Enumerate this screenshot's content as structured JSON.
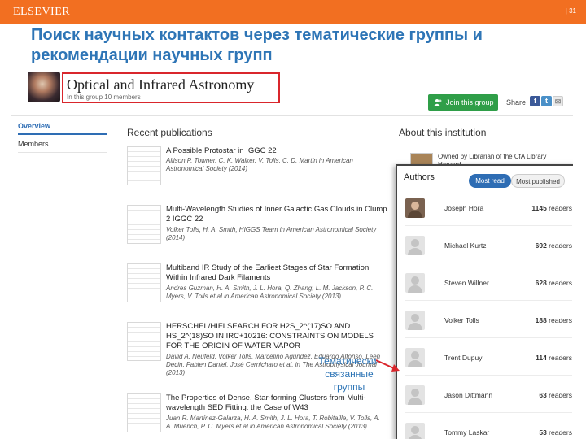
{
  "slide": {
    "brand": "ELSEVIER",
    "number": "| 31",
    "title": "Поиск научных контактов через тематические группы и рекомендации научных групп",
    "callout": "Тематически-связанные группы"
  },
  "group": {
    "name": "Optical and Infrared Astronomy",
    "meta": "In this group 10 members",
    "join_label": "Join this group",
    "share_label": "Share"
  },
  "nav": {
    "items": [
      "Overview",
      "Members"
    ]
  },
  "publications": {
    "heading": "Recent publications",
    "items": [
      {
        "title": "A Possible Protostar in IGGC 22",
        "authors": "Allison P. Towner, C. K. Walker, V. Tolls, C. D. Martin in American Astronomical Society (2014)"
      },
      {
        "title": "Multi-Wavelength Studies of Inner Galactic Gas Clouds in Clump 2 IGGC 22",
        "authors": "Volker Tolls, H. A. Smith, HIGGS Team in American Astronomical Society (2014)"
      },
      {
        "title": "Multiband IR Study of the Earliest Stages of Star Formation Within Infrared Dark Filaments",
        "authors": "Andres Guzman, H. A. Smith, J. L. Hora, Q. Zhang, L. M. Jackson, P. C. Myers, V. Tolls et al in American Astronomical Society (2013)"
      },
      {
        "title": "HERSCHEL/HIFI SEARCH FOR H2S_2^(17)SO AND HS_2^(18)SO IN IRC+10216: CONSTRAINTS ON MODELS FOR THE ORIGIN OF WATER VAPOR",
        "authors": "David A. Neufeld, Volker Tolls, Marcelino Agúndez, Eduardo Alfonso, Leen Decin, Fabien Daniel, José Cernicharo et al. in The Astrophysical Journal (2013)"
      },
      {
        "title": "The Properties of Dense, Star-forming Clusters from Multi-wavelength SED Fitting: the Case of W43",
        "authors": "Juan R. Martínez-Galarza, H. A. Smith, J. L. Hora, T. Robitaille, V. Tolls, A. A. Muench, P. C. Myers et al in American Astronomical Society (2013)"
      }
    ]
  },
  "about": {
    "heading": "About this institution",
    "text": "Owned by Librarian of the CfA Library Harvard..."
  },
  "authors": {
    "heading": "Authors",
    "tabs": [
      "Most read",
      "Most published"
    ],
    "rows": [
      {
        "name": "Joseph Hora",
        "count": "1145",
        "suffix": " readers"
      },
      {
        "name": "Michael Kurtz",
        "count": "692",
        "suffix": " readers"
      },
      {
        "name": "Steven Willner",
        "count": "628",
        "suffix": " readers"
      },
      {
        "name": "Volker Tolls",
        "count": "188",
        "suffix": " readers"
      },
      {
        "name": "Trent Dupuy",
        "count": "114",
        "suffix": " readers"
      },
      {
        "name": "Jason Dittmann",
        "count": "63",
        "suffix": " readers"
      },
      {
        "name": "Tommy Laskar",
        "count": "53",
        "suffix": " readers"
      }
    ]
  },
  "colors": {
    "brand_orange": "#f26f21",
    "title_blue": "#2e75b6",
    "highlight_red": "#d9262c",
    "join_green": "#2f9e48",
    "tab_blue": "#2e6db4"
  }
}
